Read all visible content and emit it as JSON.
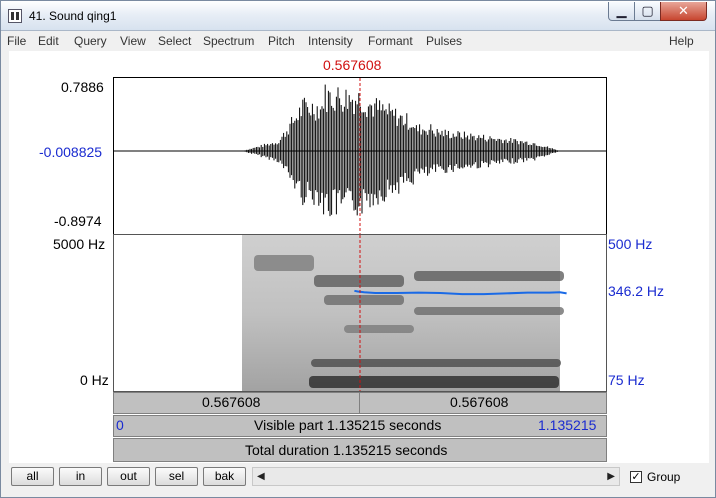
{
  "window": {
    "title": "41. Sound qing1",
    "min_glyph": "▁",
    "max_glyph": "▢",
    "close_glyph": "✕"
  },
  "menu": [
    "File",
    "Edit",
    "Query",
    "View",
    "Select",
    "Spectrum",
    "Pitch",
    "Intensity",
    "Formant",
    "Pulses",
    "Help"
  ],
  "cursor": {
    "time_label": "0.567608",
    "color": "#d01010"
  },
  "waveform": {
    "ymax_label": "0.7886",
    "ymid_label": "-0.008825",
    "ymin_label": "-0.8974"
  },
  "spectrogram": {
    "left_top_label": "5000 Hz",
    "left_bottom_label": "0 Hz",
    "pitch_top_label": "500 Hz",
    "pitch_value_label": "346.2 Hz",
    "pitch_bottom_label": "75 Hz",
    "pitch_color": "#1a6ae6",
    "pitch_track": [
      [
        0.5525,
        350
      ],
      [
        0.56,
        348
      ],
      [
        0.5675,
        347
      ],
      [
        0.575,
        346
      ],
      [
        0.6,
        344
      ],
      [
        0.65,
        344
      ],
      [
        0.7,
        345
      ],
      [
        0.75,
        344
      ],
      [
        0.8,
        341
      ],
      [
        0.85,
        341
      ],
      [
        0.9,
        343
      ],
      [
        0.95,
        345
      ],
      [
        1.0,
        345
      ],
      [
        1.025,
        346
      ],
      [
        1.04,
        343
      ]
    ]
  },
  "selection_bar": {
    "left": "0.567608",
    "right": "0.567608"
  },
  "visible_bar": {
    "start": "0",
    "text": "Visible part 1.135215 seconds",
    "end": "1.135215"
  },
  "total_bar": {
    "text": "Total duration 1.135215 seconds"
  },
  "buttons": {
    "all": "all",
    "in": "in",
    "out": "out",
    "sel": "sel",
    "bak": "bak"
  },
  "scroll": {
    "left_arrow": "◀",
    "right_arrow": "▶"
  },
  "group": {
    "label": "Group",
    "checked": "✓"
  },
  "colors": {
    "blue_labels": "#1a2bd0",
    "panel_gray": "#c0c0c0"
  }
}
